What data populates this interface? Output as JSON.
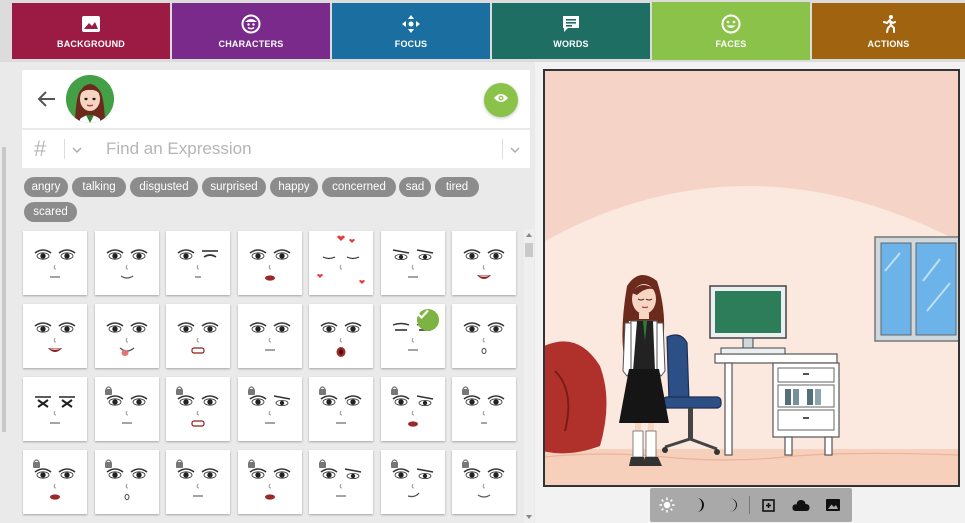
{
  "tabs": [
    {
      "label": "BACKGROUND",
      "icon": "image-icon",
      "color": "#9c1b44"
    },
    {
      "label": "CHARACTERS",
      "icon": "smiley-face-icon",
      "color": "#7a2a8a"
    },
    {
      "label": "FOCUS",
      "icon": "move-arrows-icon",
      "color": "#1a6fa0"
    },
    {
      "label": "WORDS",
      "icon": "speech-bubble-icon",
      "color": "#1f6e63"
    },
    {
      "label": "FACES",
      "icon": "smile-icon",
      "color": "#8bc34a",
      "active": true
    },
    {
      "label": "ACTIONS",
      "icon": "running-figure-icon",
      "color": "#a06410"
    }
  ],
  "search": {
    "hash": "#",
    "placeholder": "Find an Expression",
    "value": ""
  },
  "chips": [
    "angry",
    "talking",
    "disgusted",
    "surprised",
    "happy",
    "concerned",
    "sad",
    "tired",
    "scared"
  ],
  "faces": {
    "selected_index": 12
  },
  "toolbar": {
    "tools": [
      "sun-icon",
      "half-moon-icon",
      "crescent-moon-icon",
      "add-frame-icon",
      "cloud-icon",
      "image-icon"
    ]
  }
}
